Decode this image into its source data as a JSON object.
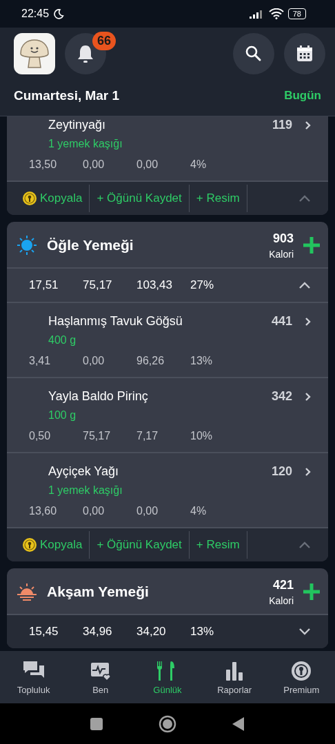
{
  "status_bar": {
    "time": "22:45",
    "battery": "78"
  },
  "header": {
    "notification_count": "66",
    "date": "Cumartesi, Mar 1",
    "today_link": "Bugün"
  },
  "meals": [
    {
      "kind": "partial",
      "expanded": true,
      "foods": [
        {
          "name": "Zeytinyağı",
          "portion": "1 yemek kaşığı",
          "calories": "119",
          "macros": [
            "13,50",
            "0,00",
            "0,00",
            "4%"
          ]
        }
      ],
      "actions": [
        {
          "kind": "copy",
          "label": "Kopyala"
        },
        {
          "kind": "add",
          "label": "+ Öğünü Kaydet"
        },
        {
          "kind": "add",
          "label": "+ Resim"
        }
      ]
    },
    {
      "kind": "lunch",
      "name": "Öğle Yemeği",
      "calories": "903",
      "calories_label": "Kalori",
      "expanded": true,
      "totals": [
        "17,51",
        "75,17",
        "103,43",
        "27%"
      ],
      "foods": [
        {
          "name": "Haşlanmış Tavuk Göğsü",
          "portion": "400 g",
          "calories": "441",
          "macros": [
            "3,41",
            "0,00",
            "96,26",
            "13%"
          ]
        },
        {
          "name": "Yayla Baldo Pirinç",
          "portion": "100 g",
          "calories": "342",
          "macros": [
            "0,50",
            "75,17",
            "7,17",
            "10%"
          ]
        },
        {
          "name": "Ayçiçek Yağı",
          "portion": "1 yemek kaşığı",
          "calories": "120",
          "macros": [
            "13,60",
            "0,00",
            "0,00",
            "4%"
          ]
        }
      ],
      "actions": [
        {
          "kind": "copy",
          "label": "Kopyala"
        },
        {
          "kind": "add",
          "label": "+ Öğünü Kaydet"
        },
        {
          "kind": "add",
          "label": "+ Resim"
        }
      ]
    },
    {
      "kind": "dinner",
      "name": "Akşam Yemeği",
      "calories": "421",
      "calories_label": "Kalori",
      "expanded": false,
      "totals": [
        "15,45",
        "34,96",
        "34,20",
        "13%"
      ]
    }
  ],
  "bottom_nav": [
    {
      "kind": "community",
      "label": "Topluluk",
      "selected": false
    },
    {
      "kind": "me",
      "label": "Ben",
      "selected": false
    },
    {
      "kind": "diary",
      "label": "Günlük",
      "selected": true
    },
    {
      "kind": "reports",
      "label": "Raporlar",
      "selected": false
    },
    {
      "kind": "premium",
      "label": "Premium",
      "selected": false
    }
  ]
}
